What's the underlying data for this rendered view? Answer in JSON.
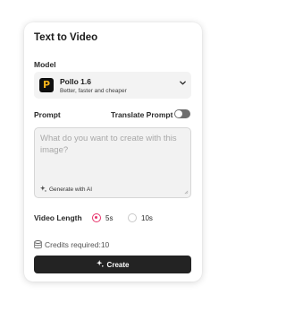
{
  "panel": {
    "title": "Text to Video"
  },
  "model": {
    "section_label": "Model",
    "logo_letter": "P",
    "name": "Pollo 1.6",
    "description": "Better, faster and cheaper",
    "chevron_icon": "chevron-down-icon"
  },
  "prompt": {
    "section_label": "Prompt",
    "translate_label": "Translate Prompt",
    "translate_enabled": false,
    "placeholder": "What do you want to create with this image?",
    "value": "",
    "generate_ai_label": "Generate with AI"
  },
  "video_length": {
    "label": "Video Length",
    "options": [
      {
        "label": "5s",
        "selected": true
      },
      {
        "label": "10s",
        "selected": false
      }
    ]
  },
  "credits": {
    "text": "Credits required:10"
  },
  "create_button": {
    "label": "Create"
  },
  "colors": {
    "accent": "#e8336b",
    "button_bg": "#232323",
    "logo_bg": "#0f0f0f",
    "logo_fg": "#f6b21b"
  }
}
